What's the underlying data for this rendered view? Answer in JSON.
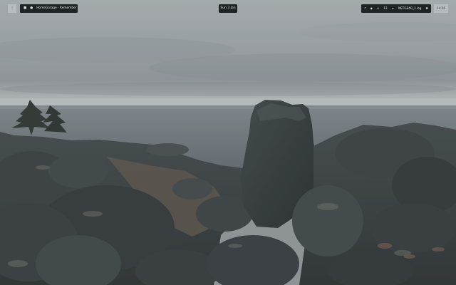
{
  "topbar": {
    "launcher_icon": "menu-icon",
    "workspaces": {
      "icons": [
        "terminal-icon",
        "globe-icon"
      ],
      "title": "HomeGarage - Remember"
    },
    "clock": "Sun 3 Jan",
    "tray": {
      "items": [
        "sound-icon",
        "lock-icon",
        "brightness-icon",
        "wifi-icon",
        "battery-icon",
        "settings-icon"
      ],
      "wifi_label": "⁶⁶",
      "network": "NETGEAR_1 log",
      "badge_value": "13"
    },
    "user_badge": "14:56"
  }
}
